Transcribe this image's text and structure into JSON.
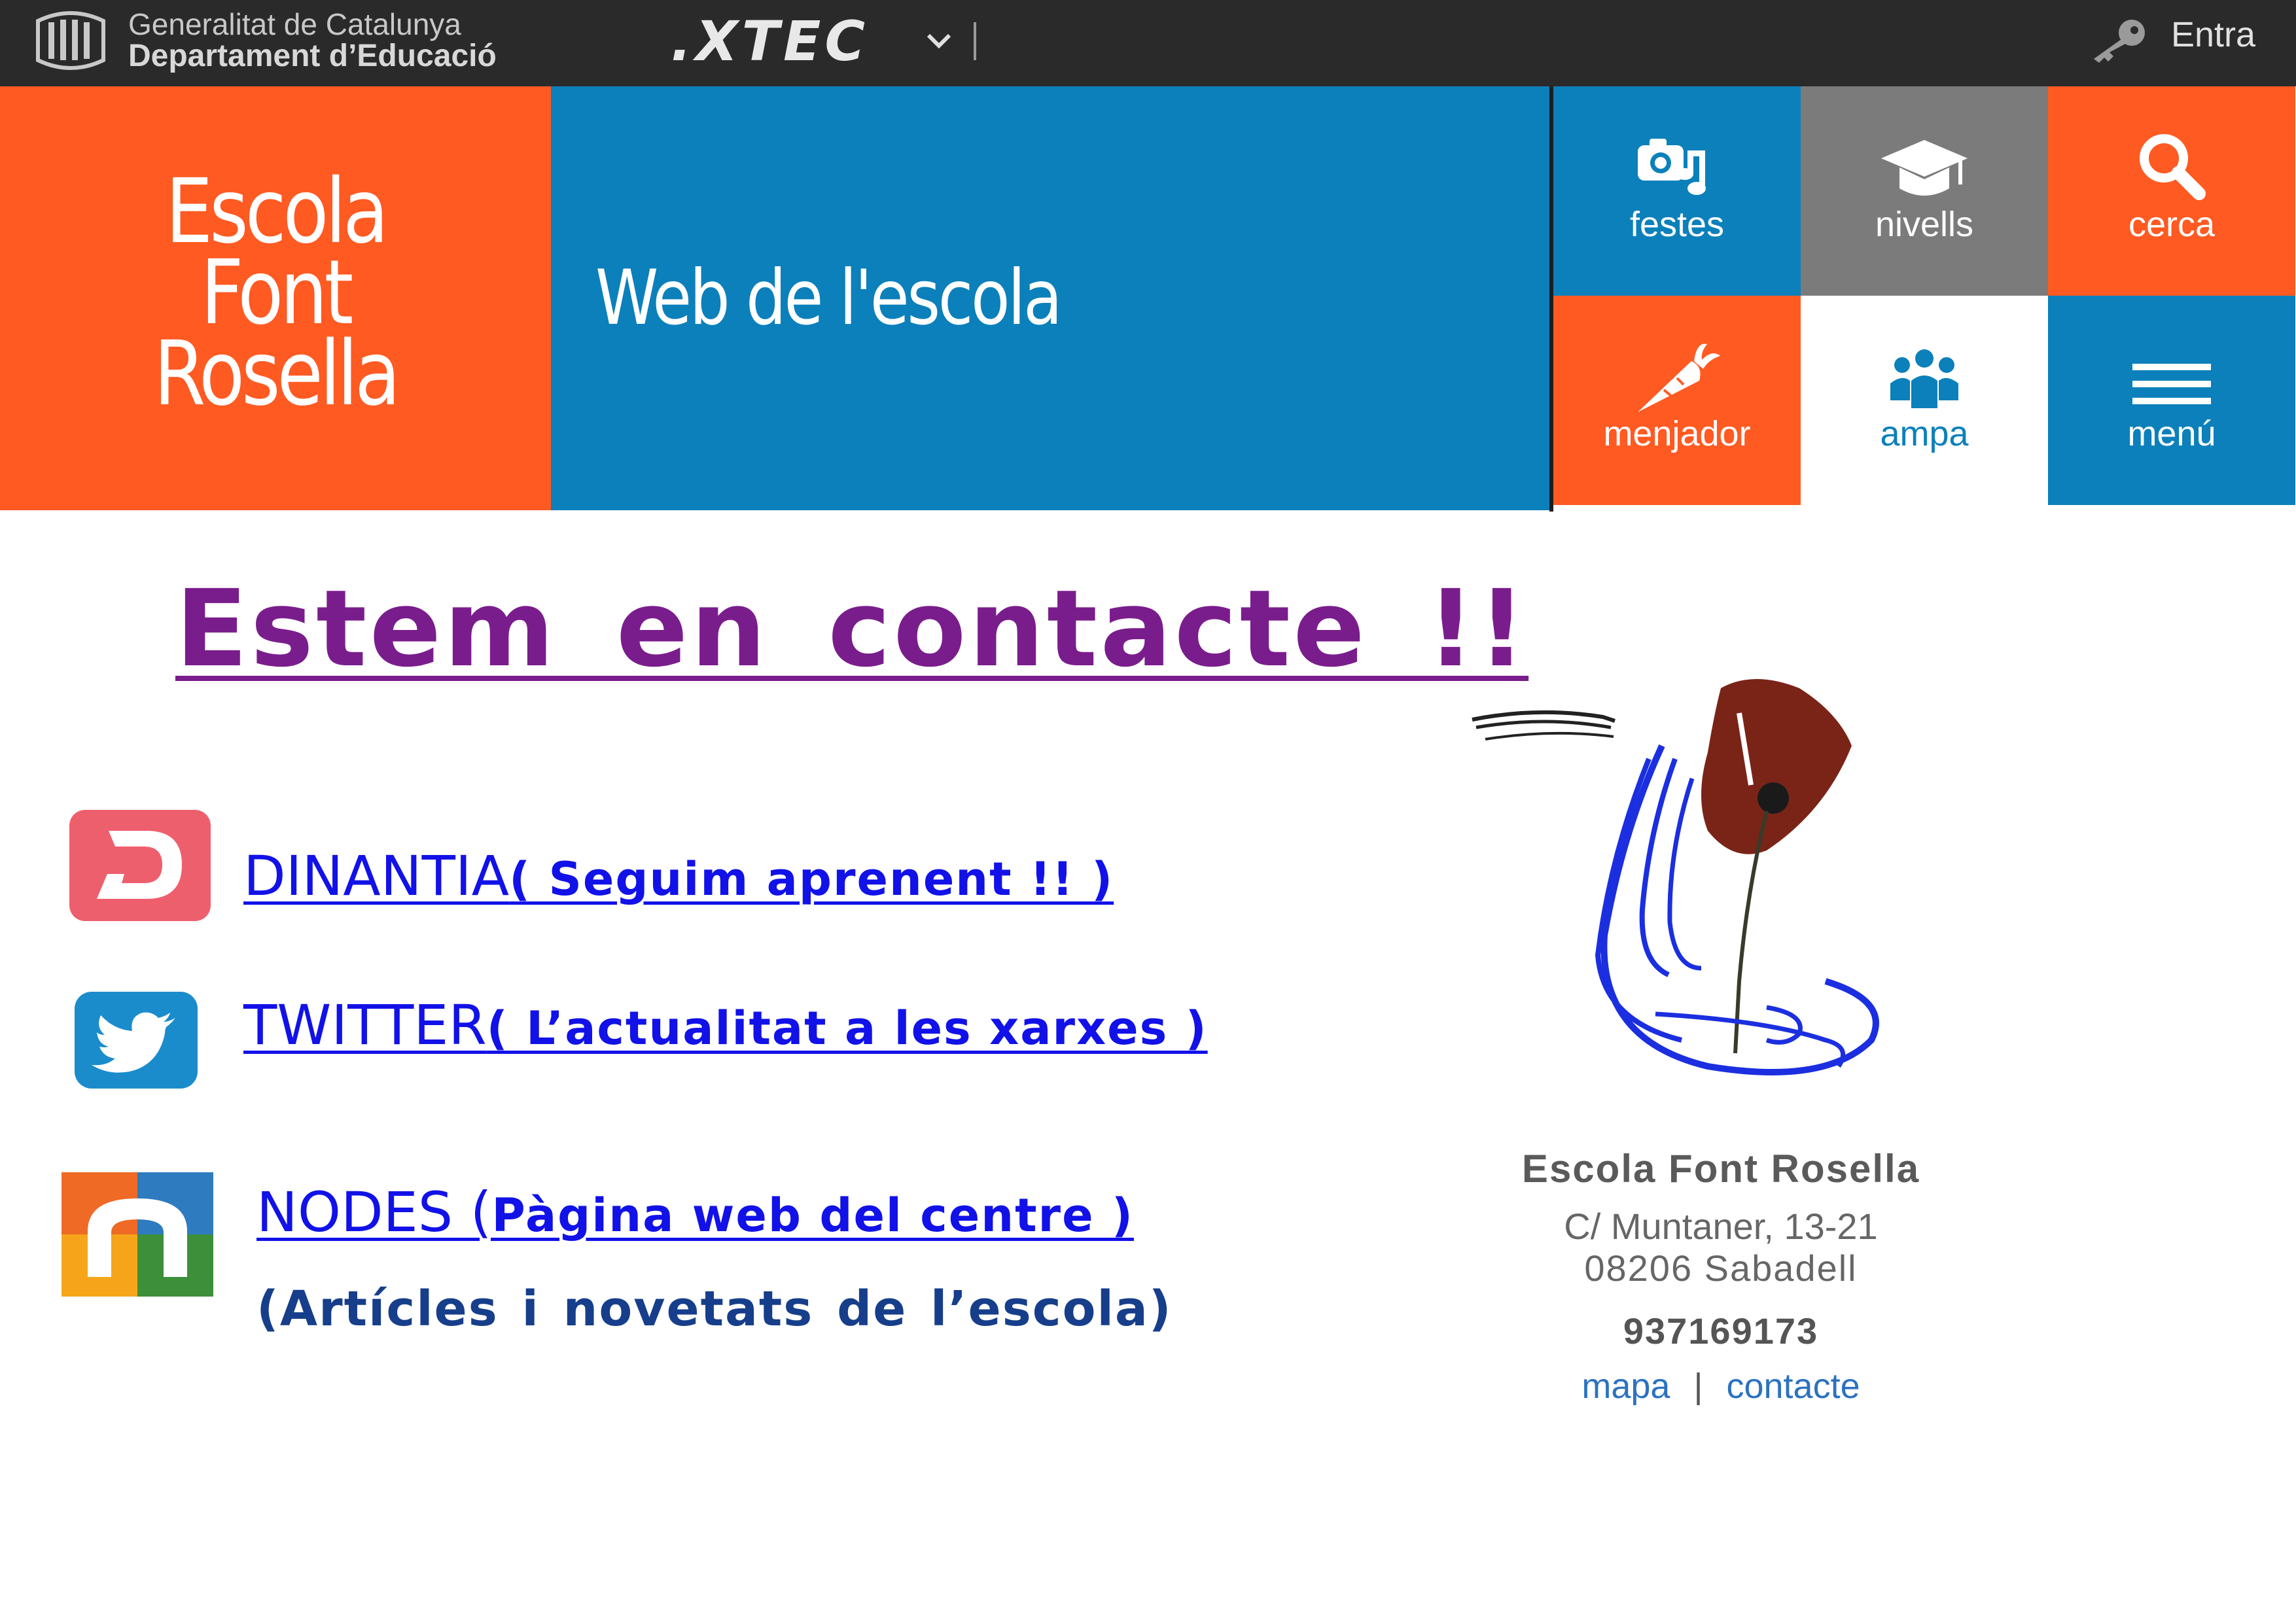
{
  "topbar": {
    "gencat_line1": "Generalitat de Catalunya",
    "gencat_line2": "Departament d’Educació",
    "xtec": ".XTEC",
    "login": "Entra"
  },
  "banner": {
    "school_name": [
      "Escola",
      "Font",
      "Rosella"
    ],
    "web_title": "Web de l'escola",
    "tiles": {
      "festes": "festes",
      "nivells": "nivells",
      "cerca": "cerca",
      "menjador": "menjador",
      "ampa": "ampa",
      "menu": "menú"
    }
  },
  "content": {
    "heading": "Estem en contacte !!",
    "links": {
      "dinantia": {
        "name": "DINANTIA",
        "desc": "( Seguim aprenent !! )"
      },
      "twitter": {
        "name": "TWITTER",
        "desc": "( L’actualitat a les xarxes )"
      },
      "nodes": {
        "name": "NODES (",
        "desc": "Pàgina web del centre )"
      }
    },
    "nodes_subtitle": "(Artícles i novetats de l’escola)"
  },
  "address": {
    "name": "Escola Font Rosella",
    "street": "C/ Muntaner, 13-21",
    "city": "08206 Sabadell",
    "phone": "937169173",
    "map_link": "mapa",
    "separator": "|",
    "contact_link": "contacte"
  },
  "colors": {
    "orange": "#ff5a22",
    "blue": "#0b80bb",
    "grey": "#7b7b7b",
    "heading_purple": "#7a1d8c",
    "link_blue": "#1111e8"
  }
}
